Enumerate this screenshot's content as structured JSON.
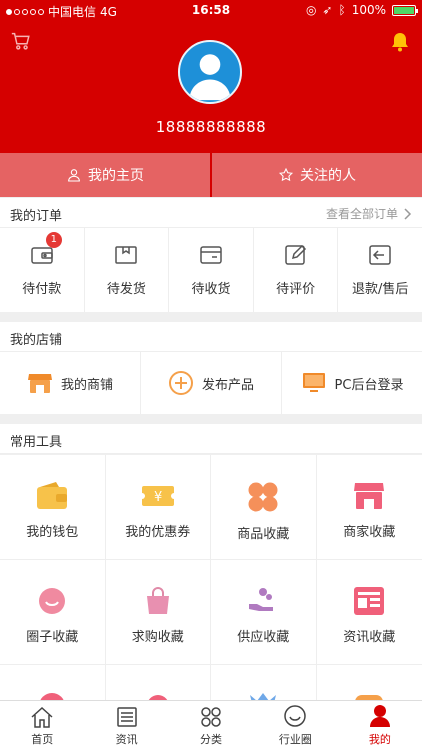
{
  "status_bar": {
    "carrier": "中国电信",
    "network": "4G",
    "time": "16:58",
    "battery": "100%"
  },
  "header": {
    "phone": "18888888888"
  },
  "profile_tabs": [
    {
      "label": "我的主页",
      "icon": "user-icon"
    },
    {
      "label": "关注的人",
      "icon": "star-icon"
    }
  ],
  "orders": {
    "title": "我的订单",
    "more": "查看全部订单",
    "items": [
      {
        "label": "待付款",
        "icon": "wallet-icon",
        "badge": "1"
      },
      {
        "label": "待发货",
        "icon": "box-icon"
      },
      {
        "label": "待收货",
        "icon": "card-icon"
      },
      {
        "label": "待评价",
        "icon": "edit-icon"
      },
      {
        "label": "退款/售后",
        "icon": "return-icon"
      }
    ]
  },
  "store": {
    "title": "我的店铺",
    "items": [
      {
        "label": "我的商铺",
        "icon": "shop-icon"
      },
      {
        "label": "发布产品",
        "icon": "plus-circle-icon"
      },
      {
        "label": "PC后台登录",
        "icon": "monitor-icon"
      }
    ]
  },
  "tools": {
    "title": "常用工具",
    "items": [
      {
        "label": "我的钱包",
        "icon": "wallet-icon"
      },
      {
        "label": "我的优惠券",
        "icon": "coupon-icon"
      },
      {
        "label": "商品收藏",
        "icon": "product-favorite-icon"
      },
      {
        "label": "商家收藏",
        "icon": "store-favorite-icon"
      },
      {
        "label": "圈子收藏",
        "icon": "circle-favorite-icon"
      },
      {
        "label": "求购收藏",
        "icon": "bag-icon"
      },
      {
        "label": "供应收藏",
        "icon": "supply-icon"
      },
      {
        "label": "资讯收藏",
        "icon": "news-icon"
      }
    ]
  },
  "tabbar": [
    {
      "label": "首页",
      "icon": "home-icon"
    },
    {
      "label": "资讯",
      "icon": "news-icon"
    },
    {
      "label": "分类",
      "icon": "category-icon"
    },
    {
      "label": "行业圈",
      "icon": "circle-icon"
    },
    {
      "label": "我的",
      "icon": "profile-icon",
      "active": true
    }
  ],
  "colors": {
    "brand": "#d50000",
    "tab_bg": "#e56363",
    "badge": "#e53935"
  }
}
